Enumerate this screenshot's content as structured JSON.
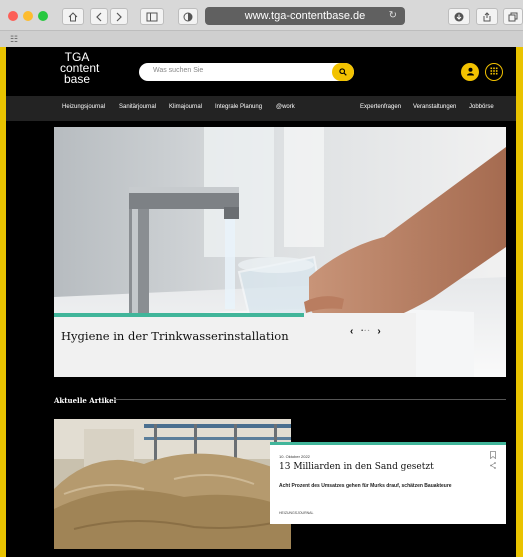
{
  "browser": {
    "url": "www.tga-contentbase.de",
    "reload_glyph": "↻",
    "tabs_glyph": "☷"
  },
  "site": {
    "logo": [
      "TGA",
      "content",
      "base"
    ],
    "search": {
      "placeholder": "Was suchen Sie",
      "icon": "search-icon"
    },
    "user_icon": "user-icon",
    "menu_icon": "grid-menu-icon"
  },
  "nav": {
    "left": [
      "Heizungsjournal",
      "Sanitärjournal",
      "Klimajournal",
      "Integrale Planung",
      "@work"
    ],
    "right": [
      "Expertenfragen",
      "Veranstaltungen",
      "Jobbörse"
    ]
  },
  "hero": {
    "title": "Hygiene in der Trinkwasserinstallation",
    "pager": {
      "prev": "‹",
      "dots": "• ◦ ◦",
      "next": "›"
    }
  },
  "section": {
    "title": "Aktuelle Artikel"
  },
  "article": {
    "date": "10. Oktober 2022",
    "title": "13 Milliarden in den Sand gesetzt",
    "lead": "Acht Prozent des Umsatzes gehen für Murks drauf, schätzen Bauakteure",
    "category": "HEIZUNGSJOURNAL",
    "bookmark_glyph": "⌑",
    "share_glyph": "≺"
  },
  "colors": {
    "accent": "#f2c200",
    "teal": "#41b59a",
    "nav_bg": "#232323"
  }
}
